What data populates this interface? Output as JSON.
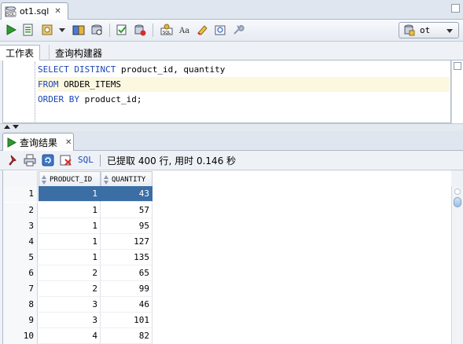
{
  "document_tab": {
    "label": "ot1.sql"
  },
  "connection": {
    "name": "ot"
  },
  "sub_tabs": [
    {
      "label": "工作表"
    },
    {
      "label": "查询构建器"
    }
  ],
  "editor": {
    "lines": [
      {
        "keyword": "SELECT DISTINCT",
        "rest": " product_id, quantity"
      },
      {
        "keyword": "FROM",
        "rest": " ORDER_ITEMS"
      },
      {
        "keyword": "ORDER BY",
        "rest": " product_id;"
      }
    ]
  },
  "results": {
    "tab_label": "查询结果",
    "sql_link": "SQL",
    "status": "已提取 400 行, 用时 0.146 秒",
    "columns": [
      {
        "label": "PRODUCT_ID"
      },
      {
        "label": "QUANTITY"
      }
    ],
    "rows": [
      {
        "n": "1",
        "product_id": "1",
        "quantity": "43"
      },
      {
        "n": "2",
        "product_id": "1",
        "quantity": "57"
      },
      {
        "n": "3",
        "product_id": "1",
        "quantity": "95"
      },
      {
        "n": "4",
        "product_id": "1",
        "quantity": "127"
      },
      {
        "n": "5",
        "product_id": "1",
        "quantity": "135"
      },
      {
        "n": "6",
        "product_id": "2",
        "quantity": "65"
      },
      {
        "n": "7",
        "product_id": "2",
        "quantity": "99"
      },
      {
        "n": "8",
        "product_id": "3",
        "quantity": "46"
      },
      {
        "n": "9",
        "product_id": "3",
        "quantity": "101"
      },
      {
        "n": "10",
        "product_id": "4",
        "quantity": "82"
      }
    ]
  },
  "colors": {
    "keyword": "#1d46b5",
    "selection": "#3a6ea5",
    "current_line": "#fcf8e0"
  }
}
